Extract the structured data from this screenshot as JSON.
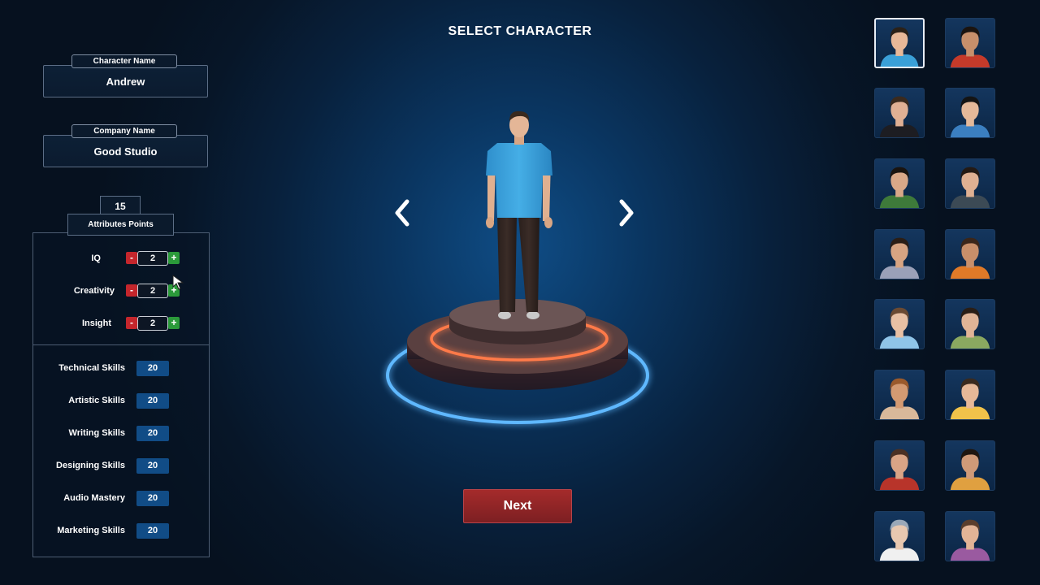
{
  "title": "SELECT CHARACTER",
  "fields": {
    "character_name": {
      "label": "Character Name",
      "value": "Andrew"
    },
    "company_name": {
      "label": "Company Name",
      "value": "Good Studio"
    }
  },
  "attributes": {
    "points": "15",
    "points_label": "Attributes Points",
    "items": [
      {
        "label": "IQ",
        "value": "2",
        "minus": "-",
        "plus": "+"
      },
      {
        "label": "Creativity",
        "value": "2",
        "minus": "-",
        "plus": "+"
      },
      {
        "label": "Insight",
        "value": "2",
        "minus": "-",
        "plus": "+"
      }
    ]
  },
  "skills": [
    {
      "label": "Technical Skills",
      "value": "20"
    },
    {
      "label": "Artistic Skills",
      "value": "20"
    },
    {
      "label": "Writing Skills",
      "value": "20"
    },
    {
      "label": "Designing Skills",
      "value": "20"
    },
    {
      "label": "Audio Mastery",
      "value": "20"
    },
    {
      "label": "Marketing Skills",
      "value": "20"
    }
  ],
  "next_label": "Next",
  "icons": {
    "prev": "chevron-left-icon",
    "next": "chevron-right-icon"
  },
  "colors": {
    "minus": "#c4262c",
    "plus": "#2b9a3a",
    "skill_badge": "#114c86",
    "next_button": "#a52b2b",
    "ring_inner": "#ff6a3a",
    "ring_outer": "#3aa0ff"
  },
  "portraits": [
    {
      "skin": "#e8b898",
      "hair": "#2b2118",
      "shirt": "#3aa0d8",
      "selected": true
    },
    {
      "skin": "#c78f6b",
      "hair": "#1b1410",
      "shirt": "#c53a2a"
    },
    {
      "skin": "#e0b094",
      "hair": "#3a2a1e",
      "shirt": "#1d1d22"
    },
    {
      "skin": "#e4b899",
      "hair": "#141414",
      "shirt": "#3b7fc0"
    },
    {
      "skin": "#d9a888",
      "hair": "#1a1410",
      "shirt": "#3e7a3a"
    },
    {
      "skin": "#dfb092",
      "hair": "#241a14",
      "shirt": "#3c4a55"
    },
    {
      "skin": "#d7a482",
      "hair": "#2b1e16",
      "shirt": "#9aa0b8"
    },
    {
      "skin": "#c88f6a",
      "hair": "#3a261a",
      "shirt": "#e07a28"
    },
    {
      "skin": "#e8c0a4",
      "hair": "#6a4a33",
      "shirt": "#8fc4e8"
    },
    {
      "skin": "#e0b496",
      "hair": "#2a1e16",
      "shirt": "#8aa860"
    },
    {
      "skin": "#d39a72",
      "hair": "#9a5a2c",
      "shirt": "#d8b89a"
    },
    {
      "skin": "#e6b898",
      "hair": "#3a2a1e",
      "shirt": "#f0c24a"
    },
    {
      "skin": "#d9a486",
      "hair": "#4a3024",
      "shirt": "#b8342a"
    },
    {
      "skin": "#cf9a78",
      "hair": "#1e1610",
      "shirt": "#e0a040"
    },
    {
      "skin": "#e8c8b0",
      "hair": "#9aa8b8",
      "shirt": "#f0f0f0"
    },
    {
      "skin": "#e2b496",
      "hair": "#5a3e2c",
      "shirt": "#9a5aa0"
    }
  ]
}
